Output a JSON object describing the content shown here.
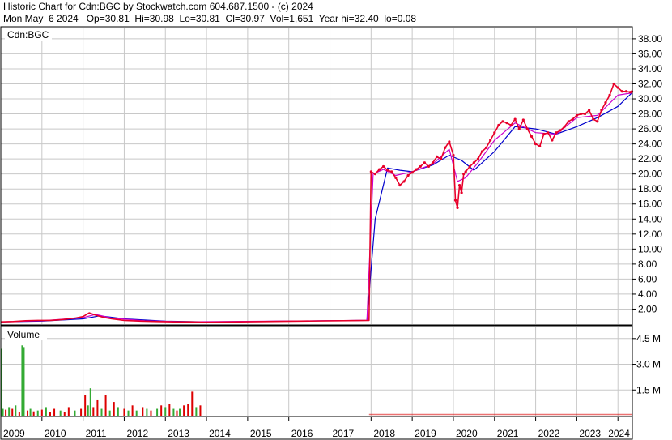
{
  "header": {
    "line1": "Historic Chart for Cdn:BGC by Stockwatch.com 604.687.1500 - (c) 2024",
    "line2": "Mon May  6 2024   Op=30.81  Hi=30.98  Lo=30.81  Cl=30.97  Vol=1,651  Year hi=32.40  lo=0.08"
  },
  "colors": {
    "price": "#e8002a",
    "ma_short": "#cc00cc",
    "ma_long": "#0000cc",
    "vol_up": "#33aa33",
    "vol_down": "#dd0000",
    "grid": "#c8c8c8"
  },
  "chart_data": [
    {
      "type": "line",
      "panel_label": "Cdn:BGC",
      "ylim": [
        0,
        39.5
      ],
      "y_ticks": [
        "2.00",
        "4.00",
        "6.00",
        "8.00",
        "10.00",
        "12.00",
        "14.00",
        "16.00",
        "18.00",
        "20.00",
        "22.00",
        "24.00",
        "26.00",
        "28.00",
        "30.00",
        "32.00",
        "34.00",
        "36.00",
        "38.00"
      ],
      "x_range": [
        2009.0,
        2024.35
      ],
      "x_tick_labels": [
        "2009",
        "2010",
        "2011",
        "2012",
        "2013",
        "2014",
        "2015",
        "2016",
        "2017",
        "2018",
        "2019",
        "2020",
        "2021",
        "2022",
        "2023",
        "2024"
      ],
      "grid": true,
      "series": [
        {
          "role": "price",
          "x": [
            2009.0,
            2009.3,
            2009.6,
            2009.9,
            2010.2,
            2010.5,
            2010.8,
            2011.0,
            2011.15,
            2011.3,
            2011.5,
            2011.7,
            2012.0,
            2012.4,
            2012.8,
            2013.2,
            2013.6,
            2013.95,
            2017.95,
            2018.0,
            2018.1,
            2018.2,
            2018.3,
            2018.4,
            2018.5,
            2018.6,
            2018.7,
            2018.8,
            2018.9,
            2019.0,
            2019.1,
            2019.2,
            2019.3,
            2019.4,
            2019.5,
            2019.6,
            2019.7,
            2019.8,
            2019.9,
            2020.0,
            2020.05,
            2020.1,
            2020.15,
            2020.2,
            2020.25,
            2020.3,
            2020.4,
            2020.5,
            2020.6,
            2020.7,
            2020.8,
            2020.9,
            2021.0,
            2021.1,
            2021.2,
            2021.3,
            2021.4,
            2021.5,
            2021.6,
            2021.7,
            2021.8,
            2021.9,
            2022.0,
            2022.1,
            2022.2,
            2022.3,
            2022.4,
            2022.5,
            2022.6,
            2022.7,
            2022.8,
            2022.9,
            2023.0,
            2023.1,
            2023.2,
            2023.3,
            2023.4,
            2023.5,
            2023.6,
            2023.7,
            2023.8,
            2023.9,
            2024.0,
            2024.1,
            2024.2,
            2024.3,
            2024.34
          ],
          "values": [
            0.3,
            0.35,
            0.45,
            0.5,
            0.5,
            0.6,
            0.8,
            1.0,
            1.5,
            1.2,
            0.9,
            0.7,
            0.5,
            0.4,
            0.35,
            0.3,
            0.3,
            0.25,
            0.5,
            20.3,
            20.0,
            20.6,
            21.0,
            20.5,
            20.3,
            19.5,
            18.5,
            19.0,
            19.8,
            20.2,
            20.6,
            21.0,
            21.5,
            21.0,
            21.5,
            22.3,
            22.0,
            23.5,
            24.3,
            22.5,
            16.5,
            15.5,
            18.5,
            17.5,
            20.0,
            20.3,
            21.0,
            21.5,
            22.0,
            23.0,
            23.5,
            24.5,
            25.5,
            26.5,
            27.0,
            26.8,
            26.5,
            27.3,
            26.0,
            27.2,
            26.0,
            25.0,
            24.0,
            23.7,
            25.3,
            25.5,
            24.5,
            25.5,
            25.8,
            26.3,
            27.0,
            27.3,
            27.8,
            28.0,
            28.0,
            28.5,
            27.3,
            27.0,
            28.5,
            29.5,
            30.5,
            32.0,
            31.5,
            31.0,
            31.0,
            30.9,
            30.97
          ]
        },
        {
          "role": "moving-average-short",
          "x": [
            2009.0,
            2010.0,
            2011.0,
            2011.3,
            2011.7,
            2012.5,
            2013.5,
            2017.9,
            2018.05,
            2018.3,
            2018.6,
            2019.0,
            2019.5,
            2019.9,
            2020.1,
            2020.3,
            2020.6,
            2021.0,
            2021.5,
            2022.0,
            2022.5,
            2023.0,
            2023.5,
            2024.0,
            2024.34
          ],
          "values": [
            0.3,
            0.45,
            0.85,
            1.3,
            0.8,
            0.45,
            0.3,
            0.5,
            20.0,
            20.6,
            19.8,
            20.3,
            21.3,
            23.3,
            19.0,
            19.5,
            21.5,
            24.5,
            26.8,
            25.5,
            25.3,
            27.5,
            27.8,
            30.5,
            30.8
          ]
        },
        {
          "role": "moving-average-long",
          "x": [
            2009.0,
            2010.0,
            2011.0,
            2011.4,
            2012.0,
            2013.0,
            2014.0,
            2017.9,
            2018.1,
            2018.4,
            2018.7,
            2019.0,
            2019.5,
            2019.9,
            2020.2,
            2020.5,
            2021.0,
            2021.5,
            2022.0,
            2022.5,
            2023.0,
            2023.5,
            2024.0,
            2024.34
          ],
          "values": [
            0.3,
            0.4,
            0.7,
            1.1,
            0.7,
            0.4,
            0.3,
            0.5,
            14.0,
            20.8,
            20.5,
            20.3,
            21.2,
            22.5,
            21.8,
            20.5,
            23.0,
            26.3,
            26.0,
            25.3,
            26.3,
            27.5,
            29.0,
            30.8
          ]
        }
      ]
    },
    {
      "type": "bar",
      "panel_label": "Volume",
      "ylim": [
        0,
        5.2
      ],
      "y_ticks": [
        "1.5 M",
        "3.0 M",
        "4.5 M"
      ],
      "grid": true,
      "x": [
        2009.02,
        2009.05,
        2009.12,
        2009.2,
        2009.28,
        2009.36,
        2009.45,
        2009.52,
        2009.56,
        2009.65,
        2009.72,
        2009.8,
        2009.9,
        2010.0,
        2010.1,
        2010.2,
        2010.3,
        2010.45,
        2010.55,
        2010.65,
        2010.8,
        2010.95,
        2011.05,
        2011.12,
        2011.18,
        2011.25,
        2011.35,
        2011.45,
        2011.55,
        2011.65,
        2011.75,
        2011.85,
        2012.0,
        2012.1,
        2012.2,
        2012.3,
        2012.45,
        2012.55,
        2012.65,
        2012.8,
        2012.9,
        2013.0,
        2013.1,
        2013.2,
        2013.28,
        2013.35,
        2013.45,
        2013.55,
        2013.65,
        2013.75,
        2013.85
      ],
      "values": [
        3.9,
        0.4,
        0.35,
        0.5,
        0.4,
        0.6,
        0.2,
        4.1,
        4.0,
        0.3,
        0.4,
        0.25,
        0.3,
        0.35,
        0.5,
        0.2,
        0.4,
        0.3,
        0.2,
        0.5,
        0.3,
        0.4,
        1.2,
        0.6,
        1.6,
        0.5,
        0.9,
        0.4,
        1.2,
        0.3,
        0.8,
        0.5,
        0.4,
        0.3,
        0.6,
        0.3,
        0.5,
        0.4,
        0.3,
        0.4,
        0.6,
        0.5,
        0.7,
        0.4,
        0.3,
        0.4,
        0.6,
        0.7,
        1.4,
        0.5,
        0.6
      ],
      "direction": [
        "u",
        "u",
        "d",
        "u",
        "d",
        "u",
        "d",
        "u",
        "u",
        "d",
        "u",
        "d",
        "u",
        "d",
        "u",
        "d",
        "d",
        "u",
        "d",
        "d",
        "u",
        "d",
        "d",
        "u",
        "u",
        "d",
        "d",
        "u",
        "d",
        "u",
        "d",
        "u",
        "d",
        "u",
        "d",
        "u",
        "d",
        "u",
        "d",
        "u",
        "d",
        "u",
        "d",
        "u",
        "d",
        "u",
        "d",
        "d",
        "d",
        "u",
        "d"
      ]
    }
  ]
}
